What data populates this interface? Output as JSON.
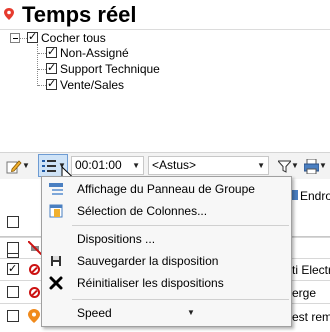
{
  "window": {
    "title": "Temps réel"
  },
  "tree": {
    "root": {
      "label": "Cocher tous",
      "checked": true
    },
    "items": [
      {
        "label": "Non-Assigné",
        "checked": true
      },
      {
        "label": "Support Technique",
        "checked": true
      },
      {
        "label": "Vente/Sales",
        "checked": true
      }
    ]
  },
  "toolbar": {
    "interval": {
      "value": "00:01:00"
    },
    "filter": {
      "value": "<Astus>"
    }
  },
  "grid": {
    "header_partial": "Endro",
    "rows": [
      {
        "checked": false,
        "text": ""
      },
      {
        "checked": true,
        "text": "ti Electro"
      },
      {
        "checked": false,
        "text": "erge"
      },
      {
        "checked": false,
        "text": "est remo"
      }
    ]
  },
  "context_menu": {
    "items": [
      {
        "label": "Affichage du Panneau de Groupe",
        "icon": "group-panel-icon"
      },
      {
        "label": "Sélection de Colonnes...",
        "icon": "column-chooser-icon"
      },
      {
        "label": "Dispositions ...",
        "icon": ""
      },
      {
        "label": "Sauvegarder la disposition",
        "icon": "save-icon"
      },
      {
        "label": "Réinitialiser les dispositions",
        "icon": "reset-x-icon"
      },
      {
        "label": "Speed",
        "icon": ""
      }
    ]
  },
  "colors": {
    "accent": "#1e5aa8",
    "stop_red": "#cc1111",
    "menu_bg": "#f7f7f7"
  }
}
